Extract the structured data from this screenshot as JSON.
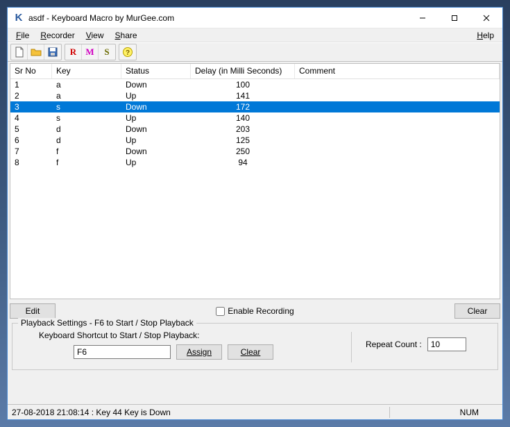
{
  "titlebar": {
    "title": "asdf - Keyboard Macro by MurGee.com"
  },
  "menu": {
    "file": "File",
    "recorder": "Recorder",
    "view": "View",
    "share": "Share",
    "help": "Help"
  },
  "columns": {
    "sr": "Sr No",
    "key": "Key",
    "status": "Status",
    "delay": "Delay (in Milli Seconds)",
    "comment": "Comment"
  },
  "rows": [
    {
      "sr": "1",
      "key": "a",
      "status": "Down",
      "delay": "100",
      "comment": "",
      "selected": false
    },
    {
      "sr": "2",
      "key": "a",
      "status": "Up",
      "delay": "141",
      "comment": "",
      "selected": false
    },
    {
      "sr": "3",
      "key": "s",
      "status": "Down",
      "delay": "172",
      "comment": "",
      "selected": true
    },
    {
      "sr": "4",
      "key": "s",
      "status": "Up",
      "delay": "140",
      "comment": "",
      "selected": false
    },
    {
      "sr": "5",
      "key": "d",
      "status": "Down",
      "delay": "203",
      "comment": "",
      "selected": false
    },
    {
      "sr": "6",
      "key": "d",
      "status": "Up",
      "delay": "125",
      "comment": "",
      "selected": false
    },
    {
      "sr": "7",
      "key": "f",
      "status": "Down",
      "delay": "250",
      "comment": "",
      "selected": false
    },
    {
      "sr": "8",
      "key": "f",
      "status": "Up",
      "delay": "94",
      "comment": "",
      "selected": false
    }
  ],
  "buttons": {
    "edit": "Edit",
    "enable_recording": "Enable Recording",
    "clear": "Clear",
    "assign": "Assign",
    "clear2": "Clear"
  },
  "playback": {
    "group_title": "Playback Settings - F6 to Start / Stop Playback",
    "shortcut_label": "Keyboard Shortcut to Start / Stop Playback:",
    "shortcut_value": "F6",
    "repeat_label": "Repeat Count :",
    "repeat_value": "10"
  },
  "status": {
    "text": "27-08-2018 21:08:14 : Key 44 Key is Down",
    "num": "NUM"
  }
}
